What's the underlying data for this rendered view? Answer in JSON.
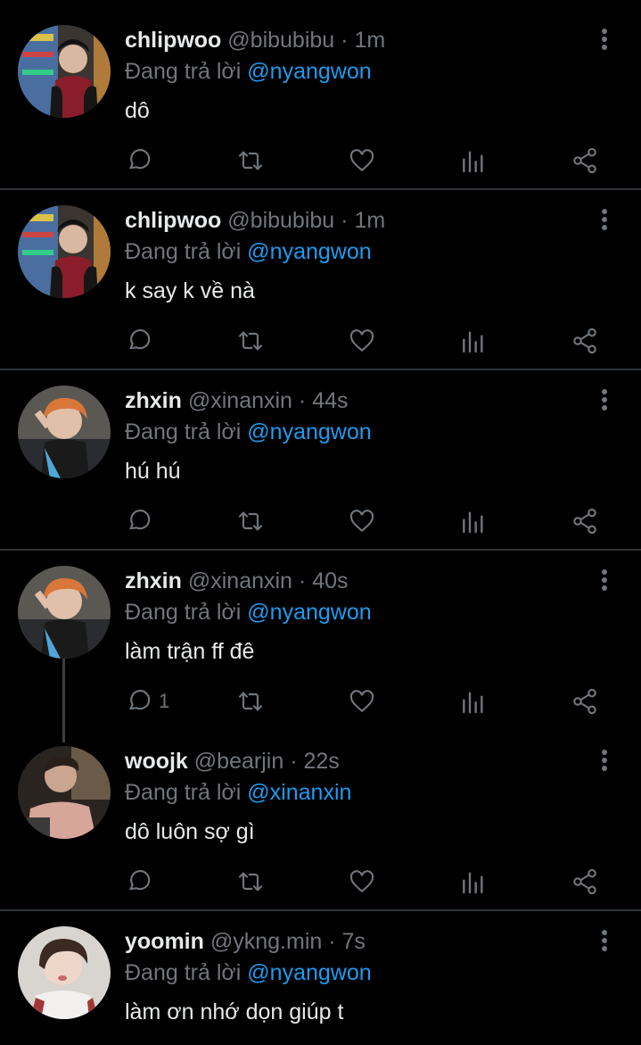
{
  "reply_prefix": "Đang trả lời",
  "colors": {
    "background": "#000000",
    "text": "#e7e9ea",
    "muted": "#71767b",
    "accent": "#1d9bf0",
    "divider": "#2f3336"
  },
  "tweets": [
    {
      "name": "chlipwoo",
      "handle": "@bibubibu",
      "sep": "·",
      "time": "1m",
      "reply_to": "@nyangwon",
      "text": "dô",
      "reply_count": ""
    },
    {
      "name": "chlipwoo",
      "handle": "@bibubibu",
      "sep": "·",
      "time": "1m",
      "reply_to": "@nyangwon",
      "text": "k say k về nà",
      "reply_count": ""
    },
    {
      "name": "zhxin",
      "handle": "@xinanxin",
      "sep": "·",
      "time": "44s",
      "reply_to": "@nyangwon",
      "text": "hú hú",
      "reply_count": ""
    },
    {
      "name": "zhxin",
      "handle": "@xinanxin",
      "sep": "·",
      "time": "40s",
      "reply_to": "@nyangwon",
      "text": "làm trận ff đê",
      "reply_count": "1"
    },
    {
      "name": "woojk",
      "handle": "@bearjin",
      "sep": "·",
      "time": "22s",
      "reply_to": "@xinanxin",
      "text": "dô luôn sợ gì",
      "reply_count": ""
    },
    {
      "name": "yoomin",
      "handle": "@ykng.min",
      "sep": "·",
      "time": "7s",
      "reply_to": "@nyangwon",
      "text": "làm ơn nhớ dọn giúp t",
      "reply_count": ""
    }
  ],
  "icons": [
    "reply-icon",
    "retweet-icon",
    "like-icon",
    "views-icon",
    "share-icon",
    "more-icon"
  ]
}
